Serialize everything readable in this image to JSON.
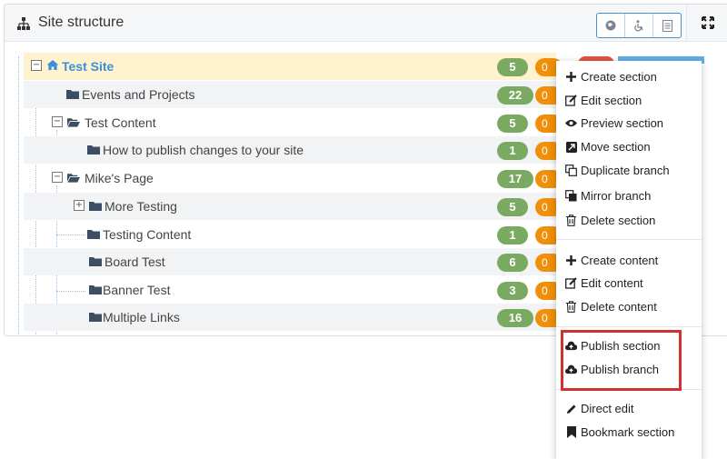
{
  "header": {
    "title": "Site structure"
  },
  "tree": {
    "rows": [
      {
        "label": "Test Site",
        "count": "5",
        "orange": "0"
      },
      {
        "label": "Events and Projects",
        "count": "22",
        "orange": "0"
      },
      {
        "label": "Test Content",
        "count": "5",
        "orange": "0"
      },
      {
        "label": "How to publish changes to your site",
        "count": "1",
        "orange": "0"
      },
      {
        "label": "Mike's Page",
        "count": "17",
        "orange": "0"
      },
      {
        "label": "More Testing",
        "count": "5",
        "orange": "0"
      },
      {
        "label": "Testing Content",
        "count": "1",
        "orange": "0"
      },
      {
        "label": "Board Test",
        "count": "6",
        "orange": "0"
      },
      {
        "label": "Banner Test",
        "count": "3",
        "orange": "0"
      },
      {
        "label": "Multiple Links",
        "count": "16",
        "orange": "0"
      }
    ]
  },
  "menu": {
    "items": [
      {
        "label": "Create section",
        "icon": "plus-icon"
      },
      {
        "label": "Edit section",
        "icon": "edit-icon"
      },
      {
        "label": "Preview section",
        "icon": "eye-icon"
      },
      {
        "label": "Move section",
        "icon": "move-icon"
      },
      {
        "label": "Duplicate branch",
        "icon": "duplicate-icon"
      },
      {
        "label": "Mirror branch",
        "icon": "mirror-icon"
      },
      {
        "label": "Delete section",
        "icon": "trash-icon"
      },
      {
        "label": "Create content",
        "icon": "plus-icon"
      },
      {
        "label": "Edit content",
        "icon": "edit-icon"
      },
      {
        "label": "Delete content",
        "icon": "trash-icon"
      },
      {
        "label": "Publish section",
        "icon": "cloud-upload-icon"
      },
      {
        "label": "Publish branch",
        "icon": "cloud-upload-icon"
      },
      {
        "label": "Direct edit",
        "icon": "pencil-icon"
      },
      {
        "label": "Bookmark section",
        "icon": "bookmark-icon"
      }
    ]
  },
  "colors": {
    "accent": "#3a8fd8",
    "badge_green": "#7aaa62",
    "badge_orange": "#f0900a",
    "highlight_red": "#d32f2f",
    "selected_row": "#fff3cf"
  }
}
